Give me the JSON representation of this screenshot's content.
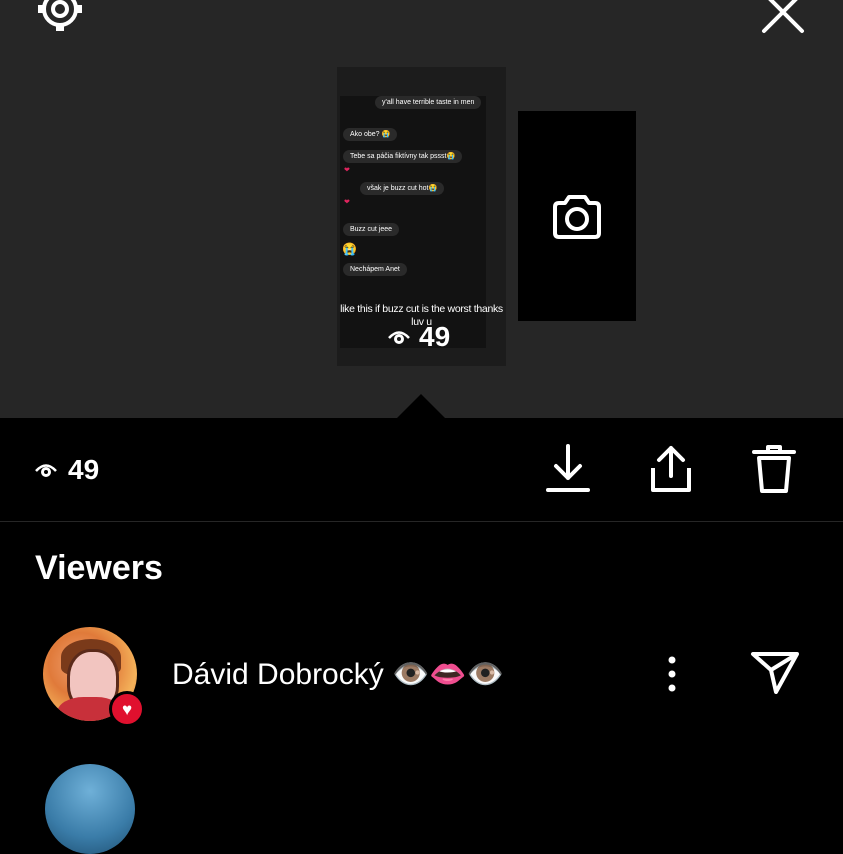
{
  "story": {
    "chat_messages": [
      {
        "text": "y'all have terrible taste in men",
        "side": "right"
      },
      {
        "text": "Ako obe? 😭",
        "side": "left"
      },
      {
        "text": "Tebe sa páčia fiktívny tak pssst😭",
        "side": "left"
      },
      {
        "text": "však je buzz cut hot😭",
        "side": "left"
      },
      {
        "text": "Buzz cut jeee",
        "side": "left"
      },
      {
        "text": "Nechápem Anet",
        "side": "left"
      }
    ],
    "reaction_emoji": "😭",
    "caption": "like this if buzz cut is the worst thanks luv u",
    "view_count": "49"
  },
  "toolbar": {
    "view_count": "49",
    "icons": [
      "eye-icon",
      "download-icon",
      "share-icon",
      "trash-icon"
    ]
  },
  "viewers": {
    "title": "Viewers",
    "items": [
      {
        "name": "Dávid Dobrocký 👁️👄👁️",
        "badge": "heart",
        "actions": [
          "more-icon",
          "send-icon"
        ]
      }
    ]
  },
  "colors": {
    "top_background": "#262626",
    "background": "#000000",
    "heart_badge": "#e0102e"
  }
}
